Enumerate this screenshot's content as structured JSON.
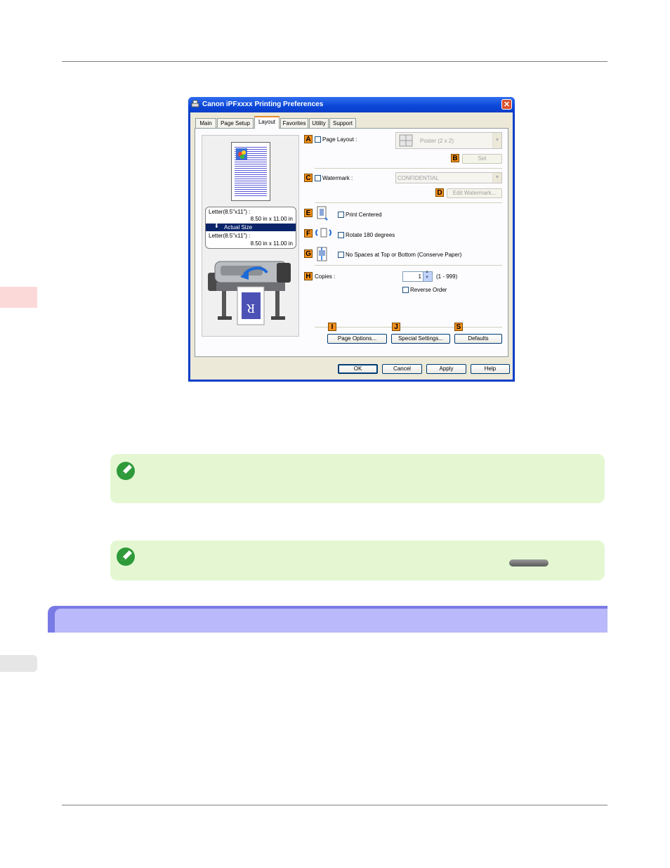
{
  "dialog": {
    "title": "Canon iPFxxxx Printing Preferences",
    "close_glyph": "✕",
    "tabs": [
      {
        "label": "Main"
      },
      {
        "label": "Page Setup"
      },
      {
        "label": "Layout"
      },
      {
        "label": "Favorites"
      },
      {
        "label": "Utility"
      },
      {
        "label": "Support"
      }
    ],
    "preview": {
      "original_label": "Letter(8.5\"x11\") :",
      "original_size": "8.50 in x 11.00 in",
      "scaling": "Actual Size",
      "output_label": "Letter(8.5\"x11\") :",
      "output_size": "8.50 in x 11.00 in",
      "paper_letter": "R"
    },
    "markers": {
      "A": "A",
      "B": "B",
      "C": "C",
      "D": "D",
      "E": "E",
      "F": "F",
      "G": "G",
      "H": "H",
      "I": "I",
      "J": "J",
      "S": "S"
    },
    "page_layout": {
      "label": "Page Layout :",
      "value": "Poster (2 x 2)",
      "set_button": "Set"
    },
    "watermark": {
      "label": "Watermark :",
      "value": "CONFIDENTIAL",
      "edit_button": "Edit Watermark..."
    },
    "print_centered": "Print Centered",
    "rotate": "Rotate 180 degrees",
    "no_spaces": "No Spaces at Top or Bottom (Conserve Paper)",
    "copies": {
      "label": "Copies :",
      "value": "1",
      "range": "(1 - 999)",
      "reverse_order": "Reverse Order"
    },
    "buttons": {
      "page_options": "Page Options...",
      "special_settings": "Special Settings...",
      "defaults": "Defaults",
      "ok": "OK",
      "cancel": "Cancel",
      "apply": "Apply",
      "help": "Help"
    }
  },
  "colors": {
    "marker_orange": "#f5911e",
    "note_green": "#e4f7d2",
    "section_band": "#b9b9fb",
    "side_tab": "#fcd9d9"
  }
}
